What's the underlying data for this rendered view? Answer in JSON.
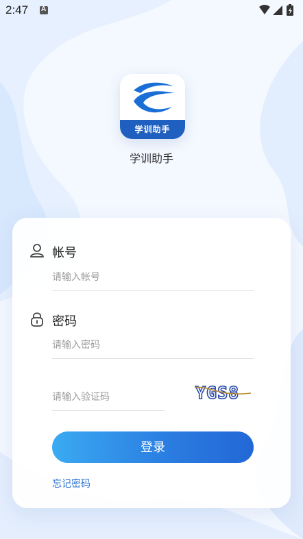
{
  "status_bar": {
    "time": "2:47"
  },
  "app": {
    "logo_text": "学训助手",
    "name": "学训助手"
  },
  "login": {
    "account_label": "帐号",
    "account_placeholder": "请输入帐号",
    "password_label": "密码",
    "password_placeholder": "请输入密码",
    "captcha_placeholder": "请输入验证码",
    "captcha_text": "YGS8",
    "submit_label": "登录",
    "forgot_label": "忘记密码"
  },
  "colors": {
    "primary": "#2a7be0",
    "link": "#2a72d4",
    "logo_strip": "#1f5fbf",
    "background": "#f3f8ff"
  },
  "icons": {
    "user": "user-icon",
    "lock": "lock-icon"
  }
}
